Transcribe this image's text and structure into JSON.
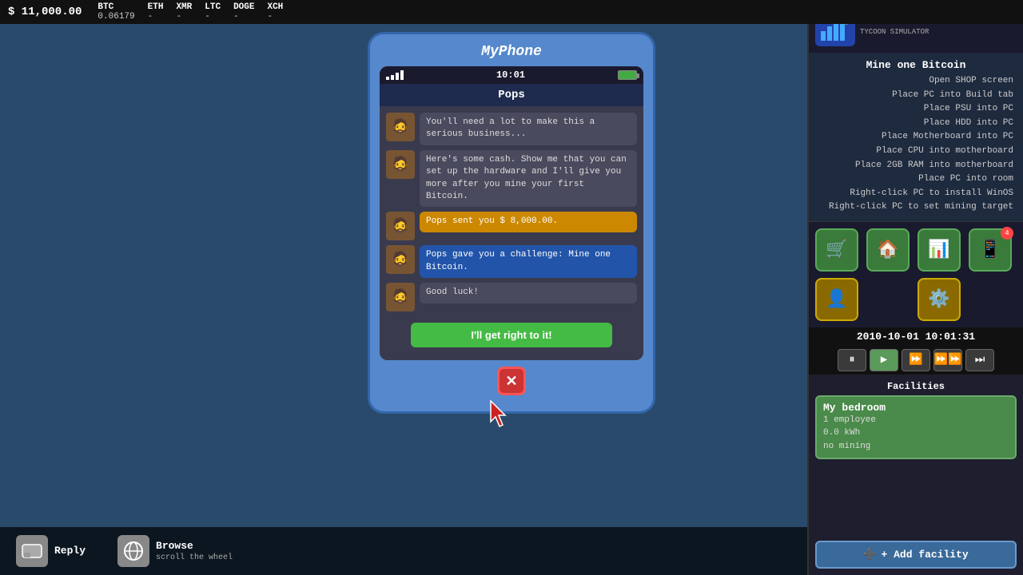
{
  "topbar": {
    "money": "$ 11,000.00",
    "cryptos": [
      {
        "symbol": "BTC",
        "value": "0.06179"
      },
      {
        "symbol": "ETH",
        "value": "-"
      },
      {
        "symbol": "XMR",
        "value": "-"
      },
      {
        "symbol": "LTC",
        "value": "-"
      },
      {
        "symbol": "DOGE",
        "value": "-"
      },
      {
        "symbol": "XCH",
        "value": "-"
      }
    ]
  },
  "phone": {
    "title": "MyPhone",
    "status": {
      "time": "10:01",
      "signal": 4,
      "battery": 80
    },
    "contact": "Pops",
    "messages": [
      {
        "id": 1,
        "text": "You'll need a lot to make this a serious business...",
        "type": "received"
      },
      {
        "id": 2,
        "text": "Here's some cash. Show me that you can set up the hardware and I'll give you more after you mine your first Bitcoin.",
        "type": "received"
      },
      {
        "id": 3,
        "text": "Pops sent you $ 8,000.00.",
        "type": "notification"
      },
      {
        "id": 4,
        "text": "Pops gave you a challenge: Mine one Bitcoin.",
        "type": "challenge"
      },
      {
        "id": 5,
        "text": "Good luck!",
        "type": "received"
      }
    ],
    "reply_button": "I'll get right to it!",
    "close_button": "✕"
  },
  "mission": {
    "title": "Mine one Bitcoin",
    "steps": [
      "Open SHOP screen",
      "Place PC into Build tab",
      "Place PSU into PC",
      "Place HDD into PC",
      "Place Motherboard into PC",
      "Place CPU into motherboard",
      "Place 2GB RAM into motherboard",
      "Place PC into room",
      "Right-click PC to install WinOS",
      "Right-click PC to set mining target"
    ]
  },
  "toolbar": {
    "buttons": [
      {
        "icon": "🛒",
        "color": "green",
        "label": "shop"
      },
      {
        "icon": "🏠",
        "color": "green",
        "label": "facilities"
      },
      {
        "icon": "📊",
        "color": "green",
        "label": "stats"
      },
      {
        "icon": "📱",
        "color": "green",
        "label": "phone",
        "badge": "4"
      },
      {
        "icon": "👤",
        "color": "yellow",
        "label": "profile"
      },
      {
        "icon": "⚙️",
        "color": "yellow",
        "label": "settings"
      }
    ]
  },
  "time_display": "2010-10-01 10:01:31",
  "speed_controls": [
    "⏸",
    "▶",
    "⏩",
    "⏩⏩",
    "⏩⏩⏩"
  ],
  "facilities": {
    "label": "Facilities",
    "list": [
      {
        "name": "My bedroom",
        "employees": "1 employee",
        "power": "0.0 kWh",
        "mining": "no mining"
      }
    ],
    "add_button": "+ Add facility"
  },
  "bottom_bar": {
    "actions": [
      {
        "icon": "💬",
        "label": "Reply",
        "sub": ""
      },
      {
        "icon": "🌐",
        "label": "Browse",
        "sub": "scroll the wheel"
      }
    ]
  }
}
